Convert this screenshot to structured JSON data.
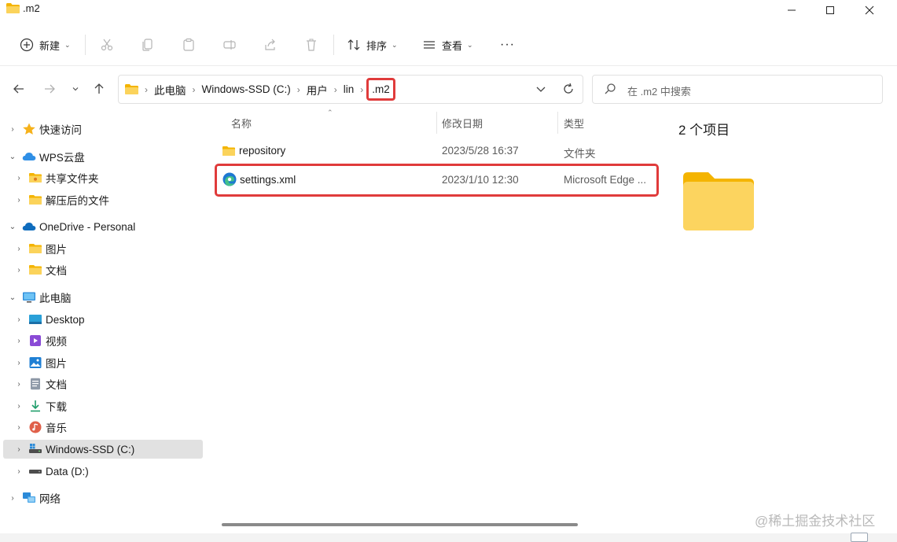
{
  "window": {
    "title": ".m2"
  },
  "toolbar": {
    "new_label": "新建",
    "sort_label": "排序",
    "view_label": "查看",
    "more_label": "···"
  },
  "address": {
    "crumbs": [
      "此电脑",
      "Windows-SSD (C:)",
      "用户",
      "lin"
    ],
    "current": ".m2"
  },
  "search": {
    "placeholder": "在 .m2 中搜索"
  },
  "sidebar": {
    "items": [
      {
        "label": "快速访问",
        "icon": "star-icon"
      },
      {
        "label": "WPS云盘",
        "icon": "cloud-icon"
      },
      {
        "label": "共享文件夹",
        "icon": "shared-folder-icon"
      },
      {
        "label": "解压后的文件",
        "icon": "folder-icon"
      },
      {
        "label": "OneDrive - Personal",
        "icon": "onedrive-icon"
      },
      {
        "label": "图片",
        "icon": "folder-icon"
      },
      {
        "label": "文档",
        "icon": "folder-icon"
      },
      {
        "label": "此电脑",
        "icon": "computer-icon"
      },
      {
        "label": "Desktop",
        "icon": "desktop-icon"
      },
      {
        "label": "视频",
        "icon": "video-icon"
      },
      {
        "label": "图片",
        "icon": "pictures-icon"
      },
      {
        "label": "文档",
        "icon": "documents-icon"
      },
      {
        "label": "下载",
        "icon": "download-icon"
      },
      {
        "label": "音乐",
        "icon": "music-icon"
      },
      {
        "label": "Windows-SSD (C:)",
        "icon": "drive-c-icon"
      },
      {
        "label": "Data (D:)",
        "icon": "drive-d-icon"
      },
      {
        "label": "网络",
        "icon": "network-icon"
      }
    ]
  },
  "columns": {
    "name": "名称",
    "modified": "修改日期",
    "type": "类型"
  },
  "files": [
    {
      "name": "repository",
      "modified": "2023/5/28 16:37",
      "type": "文件夹",
      "icon": "folder-icon"
    },
    {
      "name": "settings.xml",
      "modified": "2023/1/10 12:30",
      "type": "Microsoft Edge ...",
      "icon": "edge-icon"
    }
  ],
  "preview": {
    "count": "2 个项目"
  },
  "watermark": "@稀土掘金技术社区",
  "colors": {
    "highlight": "#e03b3b",
    "folder": "#f7c948",
    "selection": "#e1e1e1"
  }
}
